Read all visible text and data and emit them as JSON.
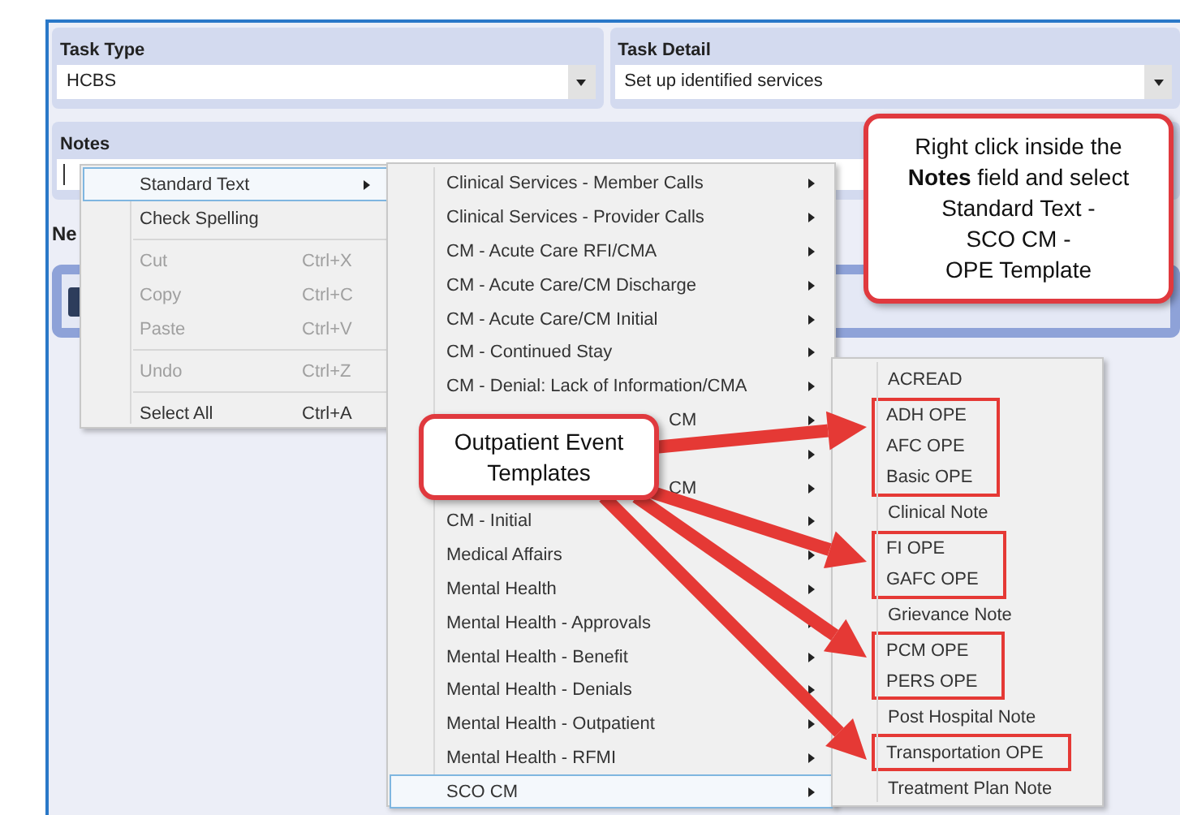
{
  "task_type": {
    "label": "Task Type",
    "value": "HCBS"
  },
  "task_detail": {
    "label": "Task Detail",
    "value": "Set up identified services"
  },
  "notes": {
    "label": "Notes"
  },
  "section_label": "Ne",
  "context_menu": {
    "items": [
      {
        "kind": "item",
        "label": "Standard Text",
        "submenu": true,
        "selected": true,
        "disabled": false
      },
      {
        "kind": "item",
        "label": "Check Spelling",
        "submenu": false,
        "selected": false,
        "disabled": false
      },
      {
        "kind": "separator"
      },
      {
        "kind": "item",
        "label": "Cut",
        "shortcut": "Ctrl+X",
        "submenu": false,
        "selected": false,
        "disabled": true
      },
      {
        "kind": "item",
        "label": "Copy",
        "shortcut": "Ctrl+C",
        "submenu": false,
        "selected": false,
        "disabled": true
      },
      {
        "kind": "item",
        "label": "Paste",
        "shortcut": "Ctrl+V",
        "submenu": false,
        "selected": false,
        "disabled": true
      },
      {
        "kind": "separator"
      },
      {
        "kind": "item",
        "label": "Undo",
        "shortcut": "Ctrl+Z",
        "submenu": false,
        "selected": false,
        "disabled": true
      },
      {
        "kind": "separator"
      },
      {
        "kind": "item",
        "label": "Select All",
        "shortcut": "Ctrl+A",
        "submenu": false,
        "selected": false,
        "disabled": false
      }
    ]
  },
  "standard_text_menu": {
    "items": [
      {
        "kind": "item",
        "label": "Clinical Services - Member Calls",
        "selected": false
      },
      {
        "kind": "item",
        "label": "Clinical Services - Provider Calls",
        "selected": false
      },
      {
        "kind": "item",
        "label": "CM - Acute Care RFI/CMA",
        "selected": false
      },
      {
        "kind": "item",
        "label": "CM - Acute Care/CM Discharge",
        "selected": false
      },
      {
        "kind": "item",
        "label": "CM - Acute Care/CM Initial",
        "selected": false
      },
      {
        "kind": "item",
        "label": "CM - Continued Stay",
        "selected": false
      },
      {
        "kind": "item",
        "label": "CM - Denial: Lack of Information/CMA",
        "selected": false
      },
      {
        "kind": "covered",
        "label": "CM",
        "selected": false
      },
      {
        "kind": "covered",
        "selected": false
      },
      {
        "kind": "covered",
        "label": "CM",
        "selected": false
      },
      {
        "kind": "item",
        "label": "CM - Initial",
        "selected": false
      },
      {
        "kind": "item",
        "label": "Medical Affairs",
        "selected": false
      },
      {
        "kind": "item",
        "label": "Mental Health",
        "selected": false
      },
      {
        "kind": "item",
        "label": "Mental Health - Approvals",
        "selected": false
      },
      {
        "kind": "item",
        "label": "Mental Health - Benefit",
        "selected": false
      },
      {
        "kind": "item",
        "label": "Mental Health - Denials",
        "selected": false
      },
      {
        "kind": "item",
        "label": "Mental Health - Outpatient",
        "selected": false
      },
      {
        "kind": "item",
        "label": "Mental Health - RFMI",
        "selected": false
      },
      {
        "kind": "item",
        "label": "SCO CM",
        "selected": true
      }
    ]
  },
  "sco_cm_menu": {
    "items": [
      {
        "label": "ACREAD",
        "boxed": false
      },
      {
        "label": "ADH OPE",
        "boxed": true
      },
      {
        "label": "AFC OPE",
        "boxed": true
      },
      {
        "label": "Basic OPE",
        "boxed": true
      },
      {
        "label": "Clinical Note",
        "boxed": false
      },
      {
        "label": "FI OPE",
        "boxed": true
      },
      {
        "label": "GAFC OPE",
        "boxed": true
      },
      {
        "label": "Grievance Note",
        "boxed": false
      },
      {
        "label": "PCM OPE",
        "boxed": true
      },
      {
        "label": "PERS OPE",
        "boxed": true
      },
      {
        "label": "Post Hospital Note",
        "boxed": false
      },
      {
        "label": "Transportation OPE",
        "boxed": true
      },
      {
        "label": "Treatment Plan Note",
        "boxed": false
      }
    ]
  },
  "callouts": [
    {
      "kind": "instruction",
      "text": "Right click inside the\n**Notes** field and select\nStandard Text -\nSCO CM -\nOPE Template"
    },
    {
      "kind": "label",
      "text": "Outpatient Event\nTemplates"
    }
  ]
}
